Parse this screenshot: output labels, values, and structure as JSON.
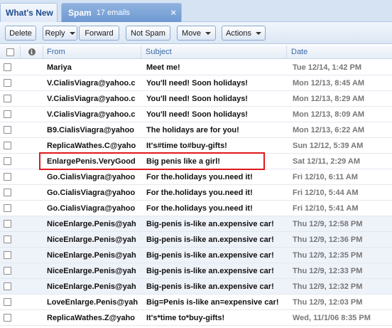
{
  "tabs": {
    "whats_new": "What's New",
    "spam": {
      "label": "Spam",
      "count": "17 emails",
      "close": "×"
    }
  },
  "toolbar": {
    "delete": "Delete",
    "reply": "Reply",
    "forward": "Forward",
    "not_spam": "Not Spam",
    "move": "Move",
    "actions": "Actions"
  },
  "columns": {
    "from": "From",
    "subject": "Subject",
    "date": "Date",
    "info_icon": "i"
  },
  "messages": [
    {
      "from": "Mariya",
      "subject": "Meet me!",
      "date": "Tue 12/14, 1:42 PM"
    },
    {
      "from": "V.CialisViagra@yahoo.c",
      "subject": "You'll need! Soon holidays!",
      "date": "Mon 12/13, 8:45 AM"
    },
    {
      "from": "V.CialisViagra@yahoo.c",
      "subject": "You'll need! Soon holidays!",
      "date": "Mon 12/13, 8:29 AM"
    },
    {
      "from": "V.CialisViagra@yahoo.c",
      "subject": "You'll need! Soon holidays!",
      "date": "Mon 12/13, 8:09 AM"
    },
    {
      "from": "B9.CialisViagra@yahoo",
      "subject": "The holidays are for you!",
      "date": "Mon 12/13, 6:22 AM"
    },
    {
      "from": "ReplicaWathes.C@yaho",
      "subject": "It's#time to#buy-gifts!",
      "date": "Sun 12/12, 5:39 AM"
    },
    {
      "from": "EnlargePenis.VeryGood",
      "subject": "Big penis like a girl!",
      "date": "Sat 12/11, 2:29 AM"
    },
    {
      "from": "Go.CialisViagra@yahoo",
      "subject": "For the.holidays you.need it!",
      "date": "Fri 12/10, 6:11 AM"
    },
    {
      "from": "Go.CialisViagra@yahoo",
      "subject": "For the.holidays you.need it!",
      "date": "Fri 12/10, 5:44 AM"
    },
    {
      "from": "Go.CialisViagra@yahoo",
      "subject": "For the.holidays you.need it!",
      "date": "Fri 12/10, 5:41 AM"
    },
    {
      "from": "NiceEnlarge.Penis@yah",
      "subject": "Big-penis is-like an.expensive car!",
      "date": "Thu 12/9, 12:58 PM"
    },
    {
      "from": "NiceEnlarge.Penis@yah",
      "subject": "Big-penis is-like an.expensive car!",
      "date": "Thu 12/9, 12:36 PM"
    },
    {
      "from": "NiceEnlarge.Penis@yah",
      "subject": "Big-penis is-like an.expensive car!",
      "date": "Thu 12/9, 12:35 PM"
    },
    {
      "from": "NiceEnlarge.Penis@yah",
      "subject": "Big-penis is-like an.expensive car!",
      "date": "Thu 12/9, 12:33 PM"
    },
    {
      "from": "NiceEnlarge.Penis@yah",
      "subject": "Big-penis is-like an.expensive car!",
      "date": "Thu 12/9, 12:32 PM"
    },
    {
      "from": "LoveEnlarge.Penis@yah",
      "subject": "Big=Penis is-like an=expensive car!",
      "date": "Thu 12/9, 12:03 PM"
    },
    {
      "from": "ReplicaWathes.Z@yaho",
      "subject": "It's*time to*buy-gifts!",
      "date": "Wed, 11/1/06 8:35 PM"
    }
  ],
  "highlighted_row": 6,
  "colors": {
    "highlight": "#e0181c",
    "tab_active": "#6f99d2",
    "header_text": "#3668a8",
    "date_text": "#777777"
  }
}
